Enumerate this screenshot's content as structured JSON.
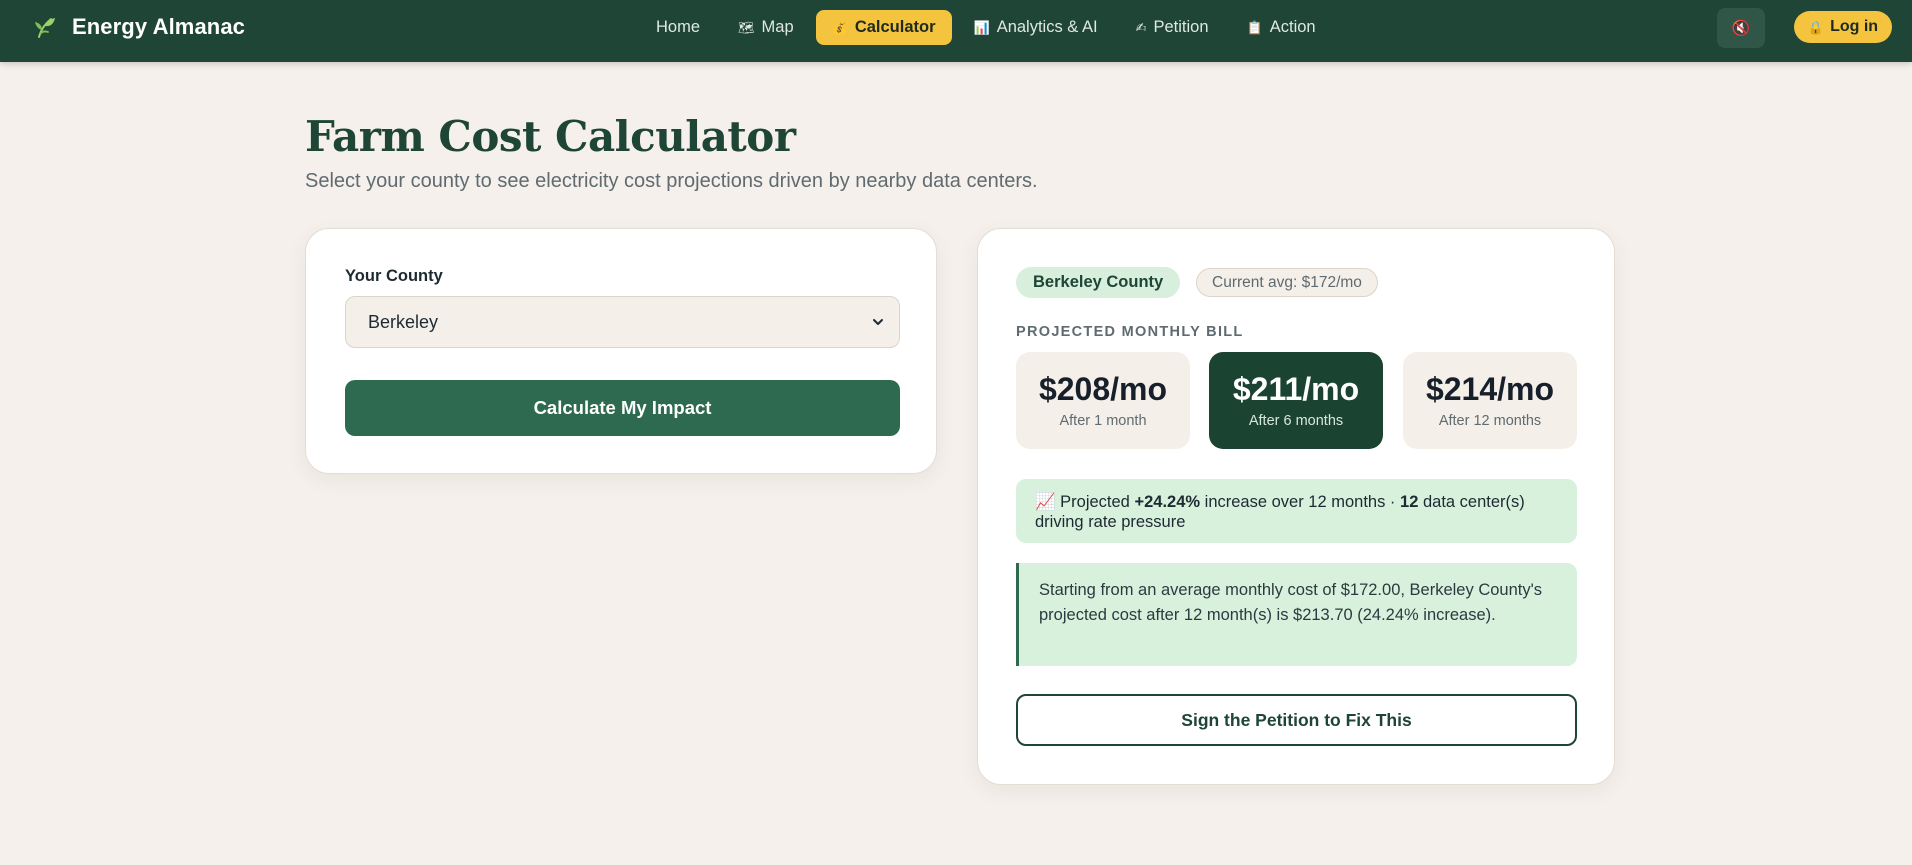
{
  "brand": {
    "name": "Energy Almanac",
    "icon": "leaf-icon"
  },
  "nav": {
    "items": [
      {
        "icon": "",
        "label": "Home",
        "active": false
      },
      {
        "icon": "🗺",
        "label": "Map",
        "active": false
      },
      {
        "icon": "💰",
        "label": "Calculator",
        "active": true
      },
      {
        "icon": "📊",
        "label": "Analytics & AI",
        "active": false
      },
      {
        "icon": "✍",
        "label": "Petition",
        "active": false
      },
      {
        "icon": "📋",
        "label": "Action",
        "active": false
      }
    ],
    "mute_icon": "🔇",
    "login_icon": "🔒",
    "login_label": "Log in"
  },
  "page": {
    "title": "Farm Cost Calculator",
    "subtitle": "Select your county to see electricity cost projections driven by nearby data centers."
  },
  "form": {
    "county_label": "Your County",
    "county_value": "Berkeley",
    "submit_label": "Calculate My Impact"
  },
  "results": {
    "county_badge": "Berkeley County",
    "current_avg": "Current avg: $172/mo",
    "section_label": "PROJECTED MONTHLY BILL",
    "projections": [
      {
        "amount": "$208/mo",
        "when": "After 1 month"
      },
      {
        "amount": "$211/mo",
        "when": "After 6 months"
      },
      {
        "amount": "$214/mo",
        "when": "After 12 months"
      }
    ],
    "insight": {
      "icon": "📈",
      "prefix": "Projected",
      "percent": "+24.24%",
      "middle": "increase over 12 months ·",
      "count": "12",
      "suffix": "data center(s) driving rate pressure"
    },
    "summary": "Starting from an average monthly cost of $172.00, Berkeley County's projected cost after 12 month(s) is $213.70 (24.24% increase).",
    "petition_label": "Sign the Petition to Fix This"
  },
  "colors": {
    "nav_bg": "#1e4535",
    "accent_yellow": "#f4c43f",
    "primary_green": "#2d6a4f",
    "highlight_tile": "#1b4332",
    "success_bg": "#d7f1dd",
    "page_bg": "#f5f0eb"
  }
}
